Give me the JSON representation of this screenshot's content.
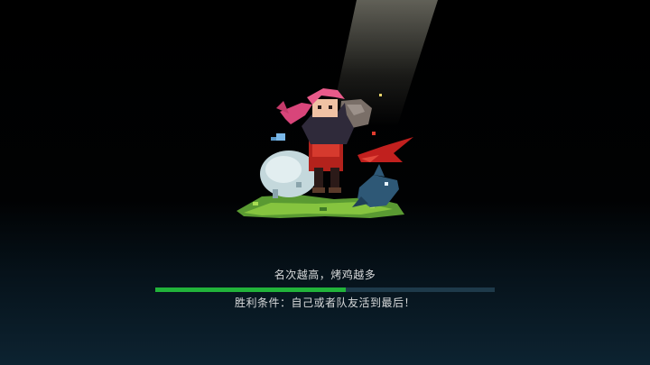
{
  "loading": {
    "tip_top": "名次越高，烤鸡越多",
    "tip_bottom": "胜利条件：自己或者队友活到最后！",
    "progress": 0.56
  },
  "colors": {
    "progress_fill": "#21b33a",
    "progress_track": "#1e3a4a",
    "text": "#d8dadb"
  }
}
